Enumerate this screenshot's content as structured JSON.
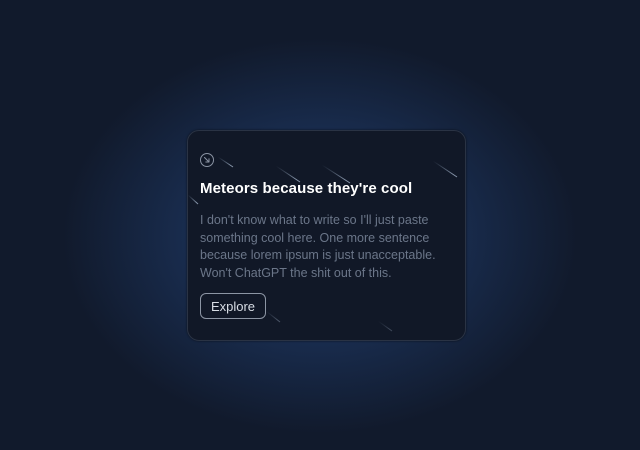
{
  "card": {
    "icon": "arrow-down-right-icon",
    "title": "Meteors because they're cool",
    "body": "I don't know what to write so I'll just paste something cool here. One more sentence because lorem ipsum is just unacceptable. Won't ChatGPT the shit out of this.",
    "button_label": "Explore"
  },
  "colors": {
    "page_background": "#111a2c",
    "card_background": "#111827",
    "glow": "#3b6eb9",
    "title": "#ffffff",
    "body_text": "#6b7689",
    "meteor": "#64748b"
  }
}
